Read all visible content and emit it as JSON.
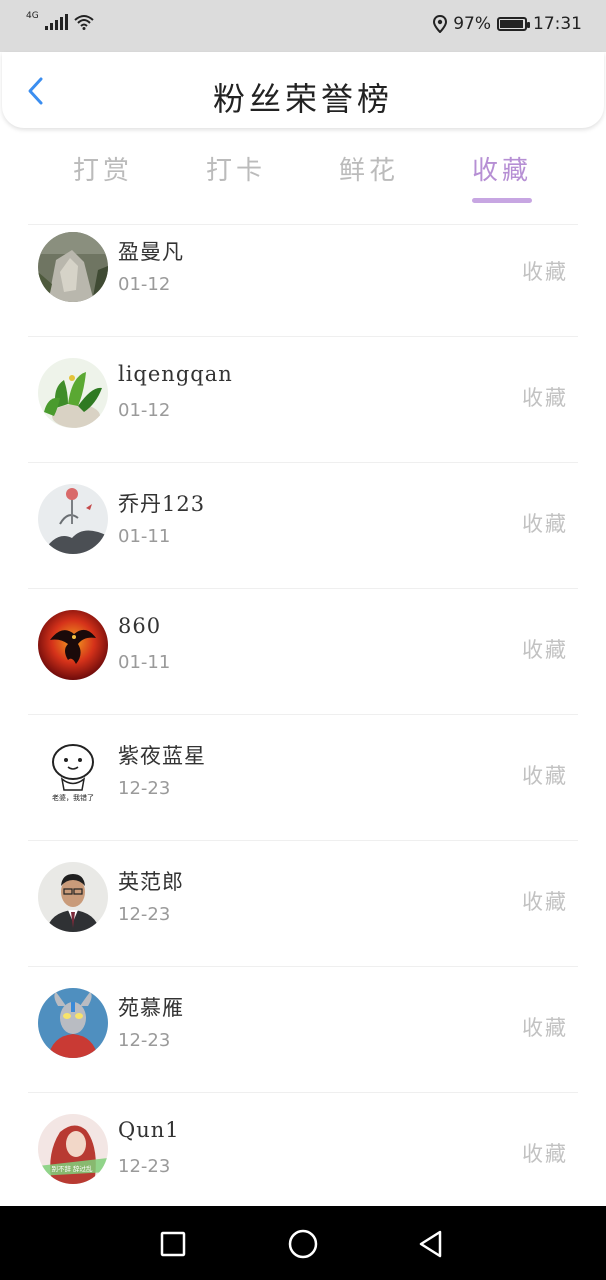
{
  "status_bar": {
    "network": "4G",
    "battery": "97%",
    "battery_level": 0.97,
    "time": "17:31"
  },
  "header": {
    "title": "粉丝荣誉榜",
    "back_icon": "chevron-left-icon",
    "accent_color": "#3b8ef0"
  },
  "tabs": {
    "items": [
      {
        "label": "打赏"
      },
      {
        "label": "打卡"
      },
      {
        "label": "鲜花"
      },
      {
        "label": "收藏"
      }
    ],
    "active_index": 3,
    "active_color": "#b68fd4"
  },
  "list": {
    "items": [
      {
        "name": "盈曼凡",
        "date": "01-12",
        "action": "收藏",
        "avatar": "rock-landscape-avatar"
      },
      {
        "name": "liqengqan",
        "date": "01-12",
        "action": "收藏",
        "avatar": "green-plant-avatar"
      },
      {
        "name": "乔丹123",
        "date": "01-11",
        "action": "收藏",
        "avatar": "ink-painting-avatar"
      },
      {
        "name": "860",
        "date": "01-11",
        "action": "收藏",
        "avatar": "red-dragon-avatar"
      },
      {
        "name": "紫夜蓝星",
        "date": "12-23",
        "action": "收藏",
        "avatar": "cartoon-face-avatar",
        "avatar_caption": "老婆，我错了"
      },
      {
        "name": "英范郎",
        "date": "12-23",
        "action": "收藏",
        "avatar": "man-portrait-avatar"
      },
      {
        "name": "苑慕雁",
        "date": "12-23",
        "action": "收藏",
        "avatar": "ultraman-avatar"
      },
      {
        "name": "Qun1",
        "date": "12-23",
        "action": "收藏",
        "avatar": "girl-red-hair-avatar",
        "avatar_caption": "别不辞 辞过乱"
      }
    ]
  },
  "nav_bar": {
    "icons": [
      "square-recents-icon",
      "circle-home-icon",
      "triangle-back-icon"
    ]
  }
}
